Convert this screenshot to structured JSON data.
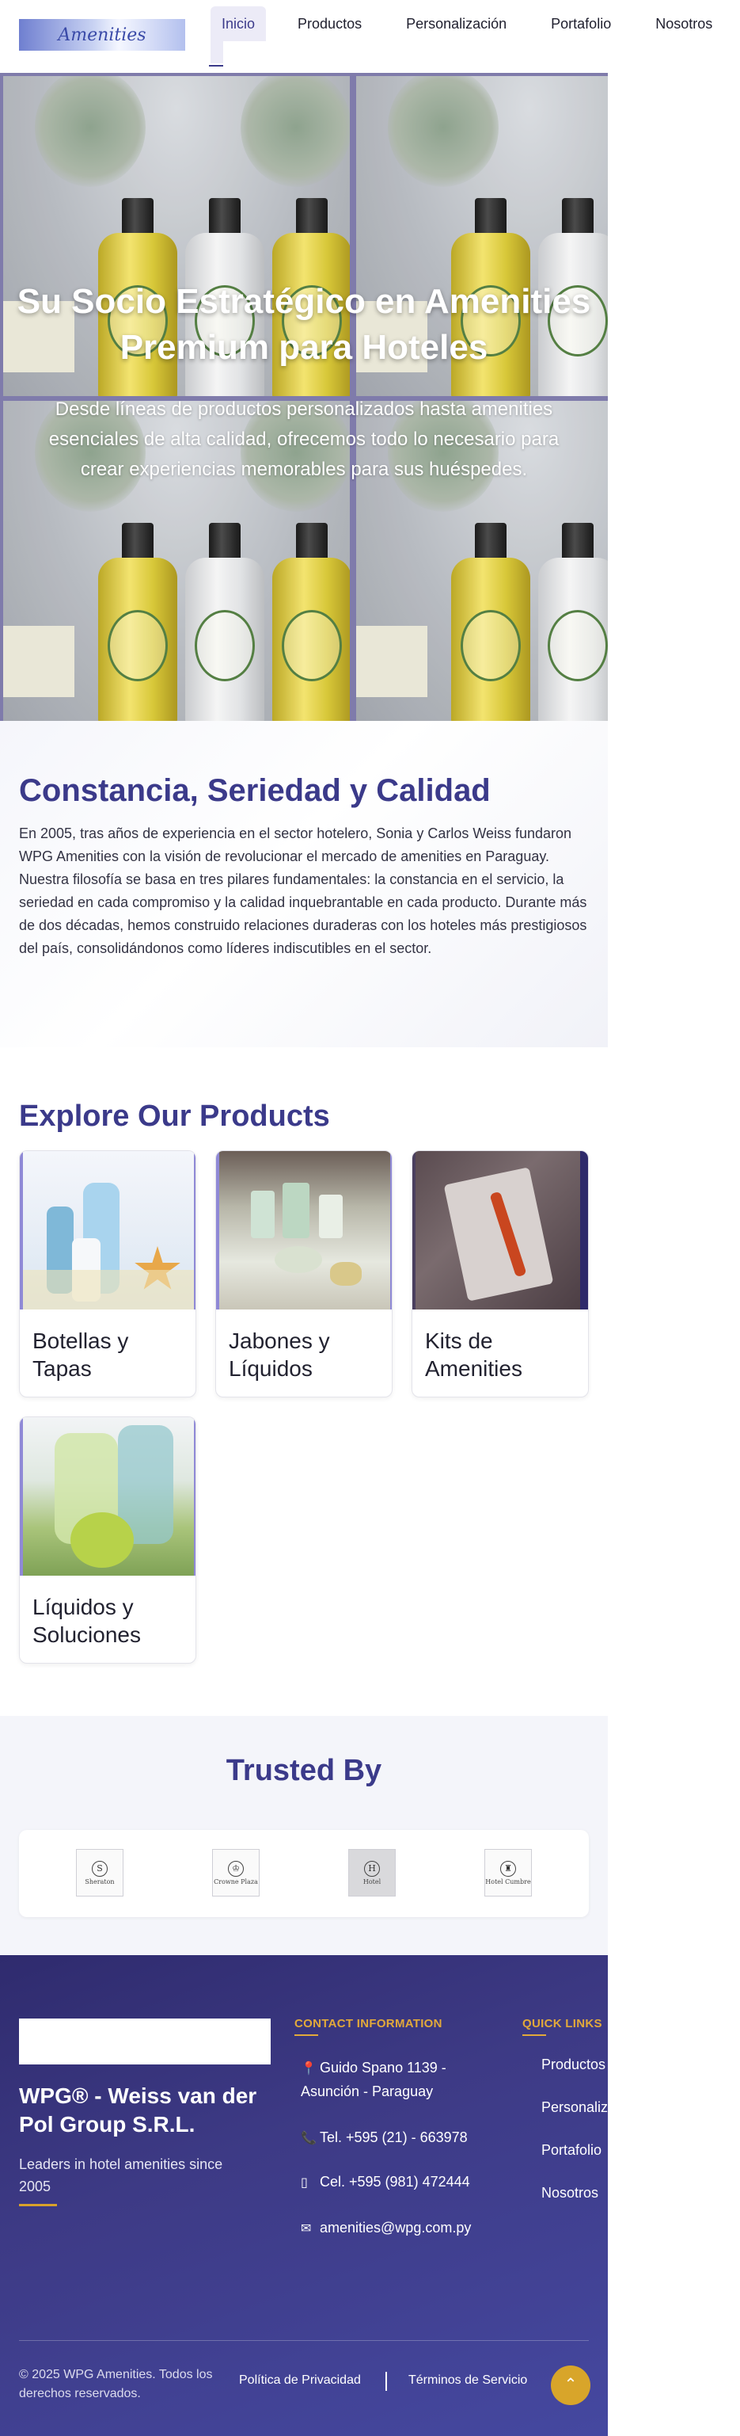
{
  "nav": {
    "logo_text": "Amenities",
    "links": [
      "Inicio",
      "Productos",
      "Personalización",
      "Portafolio",
      "Nosotros"
    ]
  },
  "hero": {
    "title": "Su Socio Estratégico en Amenities Premium para Hoteles",
    "subtitle": "Desde líneas de productos personalizados hasta amenities esenciales de alta calidad, ofrecemos todo lo necesario para crear experiencias memorables para sus huéspedes."
  },
  "about": {
    "title": "Constancia, Seriedad y Calidad",
    "body": "En 2005, tras años de experiencia en el sector hotelero, Sonia y Carlos Weiss fundaron WPG Amenities con la visión de revolucionar el mercado de amenities en Paraguay. Nuestra filosofía se basa en tres pilares fundamentales: la constancia en el servicio, la seriedad en cada compromiso y la calidad inquebrantable en cada producto. Durante más de dos décadas, hemos construido relaciones duraderas con los hoteles más prestigiosos del país, consolidándonos como líderes indiscutibles en el sector."
  },
  "products": {
    "title": "Explore Our Products",
    "items": [
      {
        "name": "Botellas y Tapas"
      },
      {
        "name": "Jabones y Líquidos"
      },
      {
        "name": "Kits de Amenities"
      },
      {
        "name": "Líquidos y Soluciones"
      }
    ]
  },
  "trusted": {
    "title": "Trusted By",
    "logos": [
      "Sheraton",
      "Crowne Plaza",
      "Hotel",
      "Hotel Cumbre"
    ]
  },
  "footer": {
    "company": "WPG® - Weiss van der Pol Group S.R.L.",
    "tagline": "Leaders in hotel amenities since 2005",
    "contact_heading": "CONTACT INFORMATION",
    "address": "Guido Spano 1139 - Asunción - Paraguay",
    "phone": "Tel. +595 (21) - 663978",
    "mobile": "Cel. +595 (981) 472444",
    "email": "amenities@wpg.com.py",
    "quick_links_heading": "QUICK LINKS",
    "quick_links": [
      "Productos",
      "Personalización",
      "Portafolio",
      "Nosotros"
    ],
    "copyright": "© 2025 WPG Amenities. Todos los derechos reservados.",
    "privacy": "Política de Privacidad",
    "terms": "Términos de Servicio",
    "back_to_top": "⌃"
  },
  "colors": {
    "brand": "#3b3a8a",
    "accent": "#d8a52a",
    "footer_bg": "#3d3a85"
  }
}
